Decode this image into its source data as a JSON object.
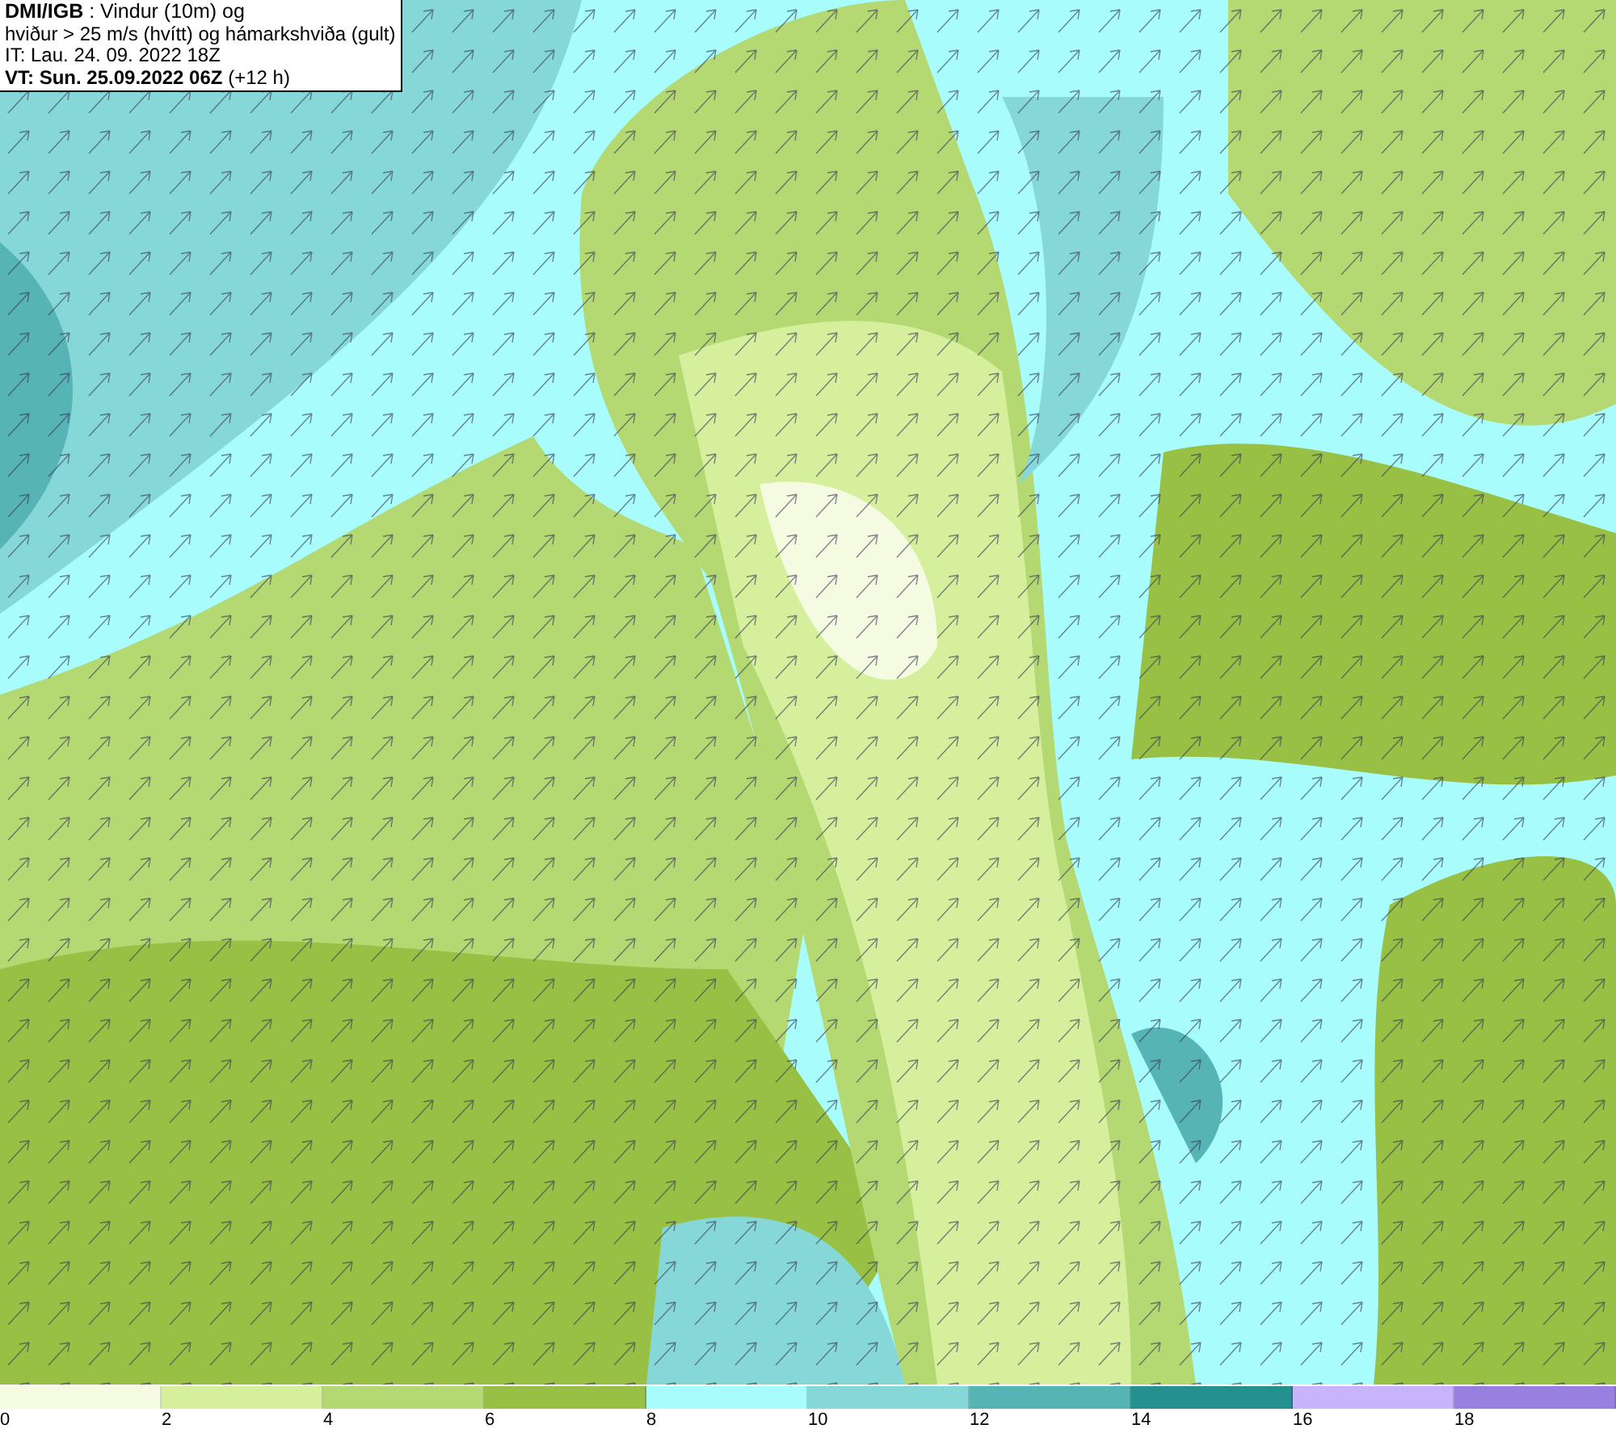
{
  "title_box": {
    "lines": [
      "**DMI/IGB** : Vindur (10m) og",
      "hviður > 25 m/s (hvítt) og hámarkshviða (gult)",
      "IT: Lau. 24. 09. 2022 18Z",
      "**VT: Sun. 25.09.2022 06Z** (+12 h)"
    ]
  },
  "legend": [
    {
      "label": "0",
      "color": "#f5fbe0"
    },
    {
      "label": "2",
      "color": "#d6ef9c"
    },
    {
      "label": "4",
      "color": "#b4d872"
    },
    {
      "label": "6",
      "color": "#98c044"
    },
    {
      "label": "8",
      "color": "#a8fcfc"
    },
    {
      "label": "10",
      "color": "#86d8d8"
    },
    {
      "label": "12",
      "color": "#56b4b4"
    },
    {
      "label": "14",
      "color": "#249090"
    },
    {
      "label": "16",
      "color": "#c8b4fc"
    },
    {
      "label": "18",
      "color": "#9880e0"
    }
  ]
}
